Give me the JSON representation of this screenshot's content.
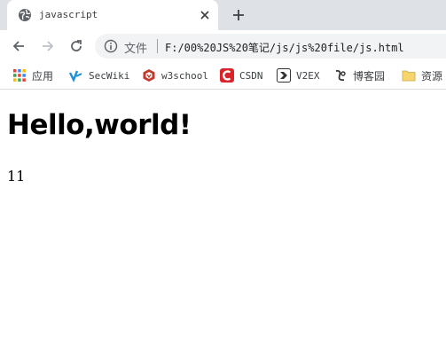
{
  "tab": {
    "title": "javascript",
    "favicon": "globe-icon",
    "close": "close-icon",
    "new_tab": "plus-icon"
  },
  "toolbar": {
    "back": "arrow-left-icon",
    "forward": "arrow-right-icon",
    "reload": "reload-icon"
  },
  "address": {
    "security": "info-icon",
    "label": "文件",
    "url": "F:/00%20JS%20笔记/js/js%20file/js.html"
  },
  "bookmarks": [
    {
      "label": "应用",
      "icon": "apps-grid-icon"
    },
    {
      "label": "SecWiki",
      "icon": "secwiki-icon"
    },
    {
      "label": "w3school",
      "icon": "w3school-icon"
    },
    {
      "label": "CSDN",
      "icon": "csdn-icon"
    },
    {
      "label": "V2EX",
      "icon": "v2ex-icon"
    },
    {
      "label": "博客园",
      "icon": "cnblogs-icon"
    },
    {
      "label": "资源",
      "icon": "folder-icon"
    }
  ],
  "page": {
    "heading": "Hello,world!",
    "output": "11"
  },
  "colors": {
    "tabstrip": "#dee1e6",
    "omnibox": "#f1f3f4",
    "icon_gray": "#5f6368"
  }
}
